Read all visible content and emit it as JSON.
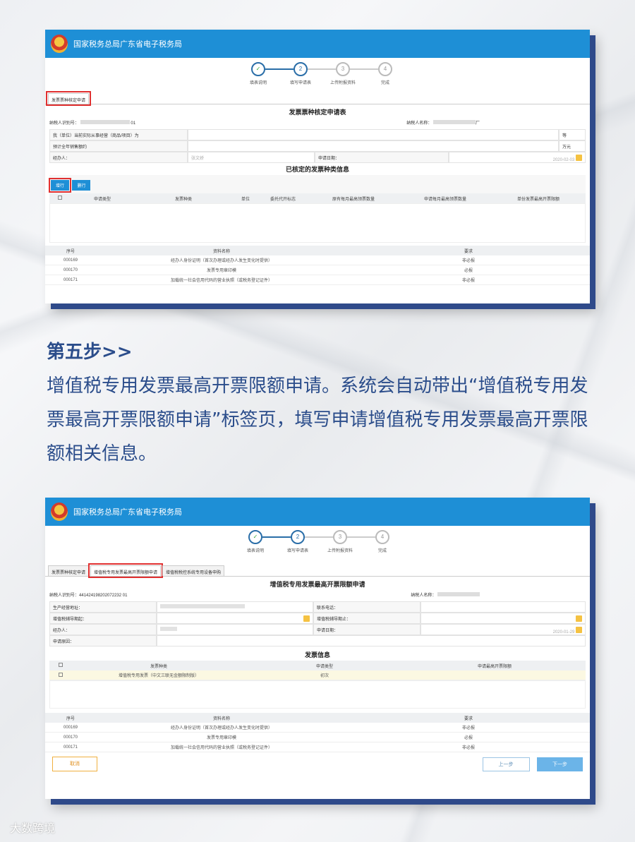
{
  "app_title": "国家税务总局广东省电子税务局",
  "steps": [
    "填表说明",
    "填写申请表",
    "上传附报资料",
    "完成"
  ],
  "step_numbers": [
    "✓",
    "2",
    "3",
    "4"
  ],
  "s1": {
    "tab": "发票票种核定申请",
    "form_title": "发票票种核定申请表",
    "taxpayer_id_label": "纳税人识别号：",
    "taxpayer_id_tail": "01",
    "taxpayer_name_label": "纳税人名称：",
    "taxpayer_name_tail": "厂",
    "business_label": "我（单位）当前实际从事经营（商品/项目）为",
    "business_suffix": "等",
    "sales_label": "预计全年销售额约",
    "sales_unit": "万元",
    "handler_label": "经办人：",
    "handler_value": "张文娇",
    "apply_date_label": "申请日期：",
    "apply_date": "2020-02-03",
    "section_title": "已核定的发票种类信息",
    "add_btn": "增行",
    "del_btn": "删行",
    "columns": [
      "申请类型",
      "发票种类",
      "单位",
      "委托代开标志",
      "原有每月最高领票数量",
      "申请每月最高领票数量",
      "单份发票最高开票限额"
    ],
    "doc_headers": [
      "序号",
      "资料名称",
      "要求"
    ],
    "docs": [
      [
        "000169",
        "经办人身份证明（首次办理或经办人发生变化时提供）",
        "非必报"
      ],
      [
        "000170",
        "发票专用章印模",
        "必报"
      ],
      [
        "000171",
        "加载统一社会信用代码的营业执照（或税务登记证件）",
        "非必报"
      ]
    ]
  },
  "text": {
    "heading": "第五步>>",
    "para": "增值税专用发票最高开票限额申请。系统会自动带出“增值税专用发票最高开票限额申请”标签页，填写申请增值税专用发票最高开票限额相关信息。"
  },
  "s2": {
    "tabs": [
      "发票票种核定申请",
      "增值税专用发票最高开票限额申请",
      "增值税税控系统专用设备申购"
    ],
    "form_title": "增值税专用发票最高开票限额申请",
    "taxpayer_id_label": "纳税人识别号：",
    "taxpayer_id": "441424198202072232 01",
    "taxpayer_name_label": "纳税人名称：",
    "addr_label": "生产经营地址：",
    "phone_label": "联系电话：",
    "period_start_label": "增值税辅导期起：",
    "period_end_label": "增值税辅导期止：",
    "handler_label": "经办人：",
    "apply_date_label": "申请日期：",
    "apply_date": "2020-01-29",
    "reason_label": "申请原因：",
    "section_title": "发票信息",
    "inv_columns": [
      "发票种类",
      "申请类型",
      "申请最高开票限额"
    ],
    "inv_row": [
      "增值税专用发票（中文三联无金额限制版）",
      "初次",
      ""
    ],
    "doc_headers": [
      "序号",
      "资料名称",
      "要求"
    ],
    "docs": [
      [
        "000169",
        "经办人身份证明（首次办理或经办人发生变化时提供）",
        "非必报"
      ],
      [
        "000170",
        "发票专用章印模",
        "必报"
      ],
      [
        "000171",
        "加载统一社会信用代码的营业执照（或税务登记证件）",
        "非必报"
      ]
    ],
    "cancel_btn": "取消",
    "prev_btn": "上一步",
    "next_btn": "下一步"
  },
  "watermark": "大数跨境"
}
